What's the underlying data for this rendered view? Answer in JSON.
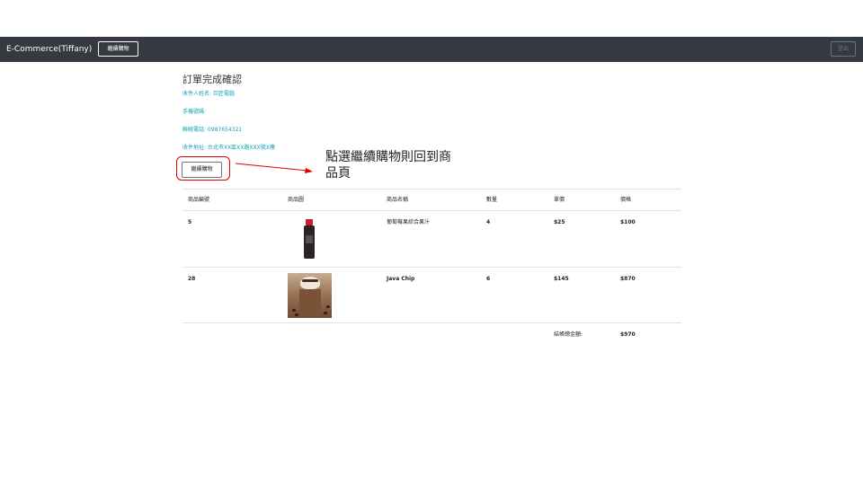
{
  "navbar": {
    "brand": "E-Commerce(Tiffany)",
    "continue_label": "繼續購物",
    "logout_label": "登出"
  },
  "order": {
    "title": "訂單完成確認",
    "recipient_name": "收件人姓名: 巨匠電腦",
    "mobile": "手機號碼:",
    "phone": "聯絡電話: 0987654321",
    "address": "收件地址: 台北市XX區XX路XXX號X樓",
    "continue_label": "繼續購物"
  },
  "annotation": {
    "text": "點選繼續購物則回到商品頁"
  },
  "table": {
    "headers": [
      "商品編號",
      "商品圖",
      "商品名稱",
      "數量",
      "單價",
      "價格"
    ],
    "rows": [
      {
        "id": "5",
        "image": "juice-bottle-image",
        "name": "葡萄莓果綜合果汁",
        "qty": "4",
        "unit_price": "$25",
        "price": "$100"
      },
      {
        "id": "28",
        "image": "java-chip-image",
        "name": "Java Chip",
        "qty": "6",
        "unit_price": "$145",
        "price": "$870"
      }
    ],
    "total_label": "結帳總金額:",
    "total_value": "$970"
  },
  "colors": {
    "navbar": "#343a40",
    "info_text": "#17a2b8",
    "annotation": "#e00000"
  }
}
